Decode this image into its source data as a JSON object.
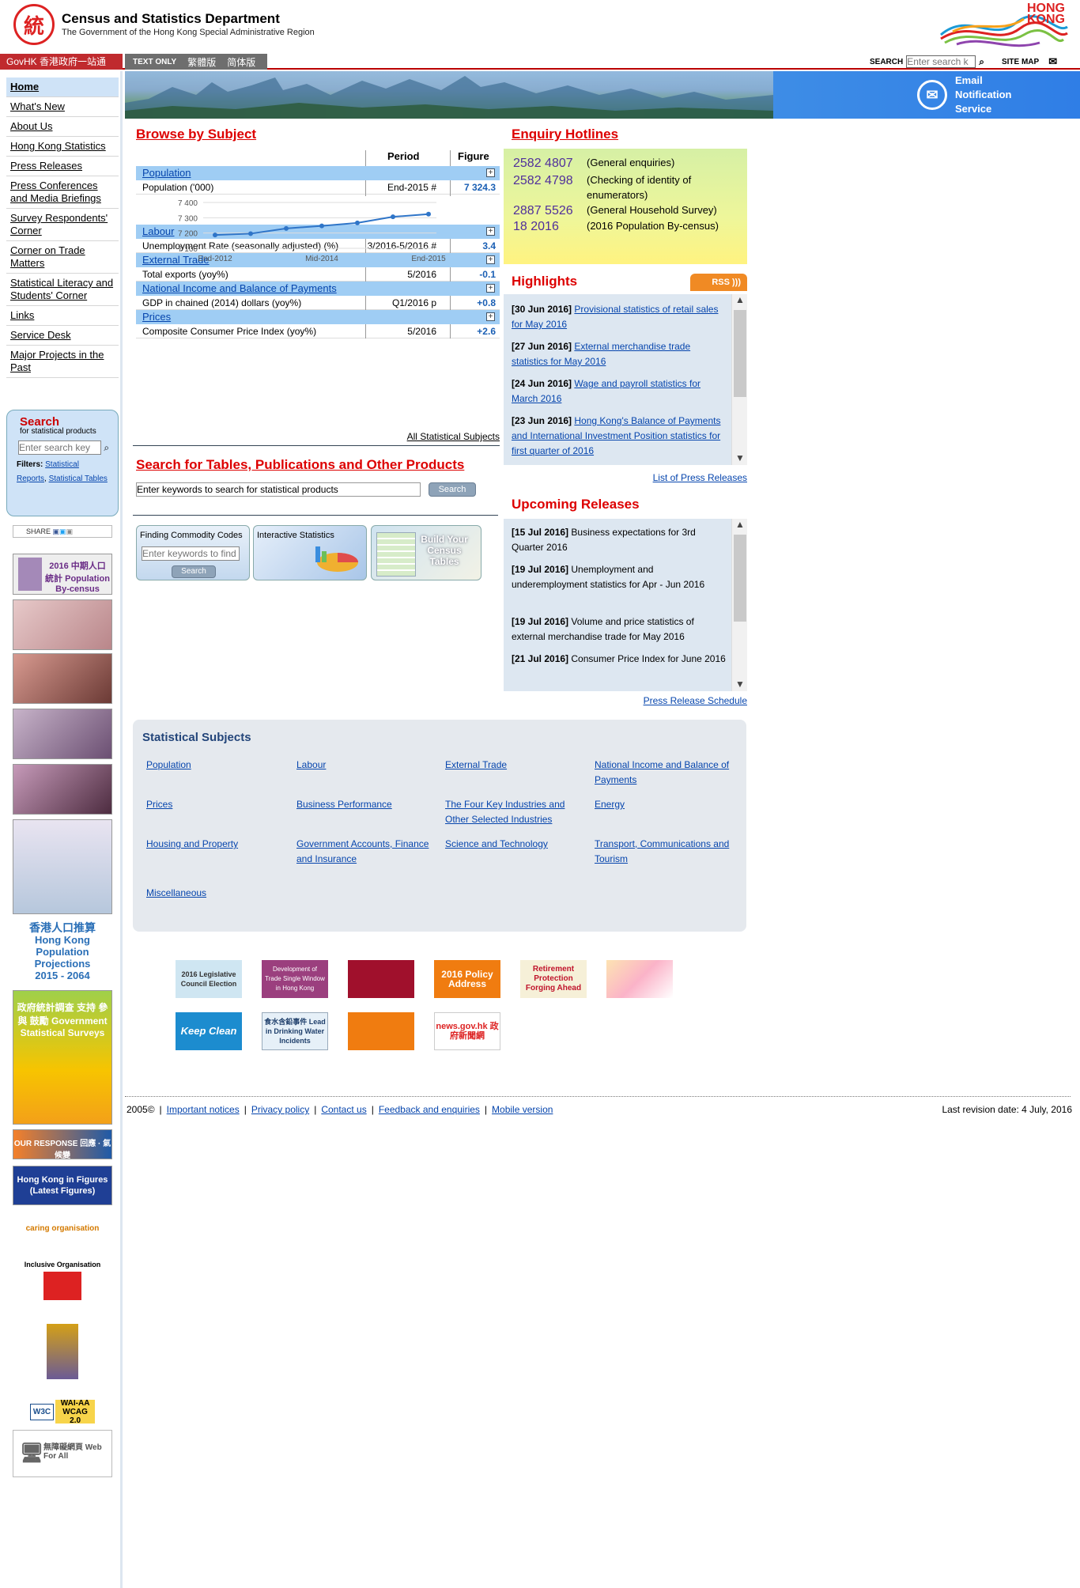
{
  "header": {
    "dept_name": "Census and Statistics Department",
    "dept_sub": "The Government of the Hong Kong Special Administrative Region",
    "brand": "HONG KONG",
    "govhk": "GovHK 香港政府一站通",
    "text_only": "TEXT ONLY",
    "lang_tc": "繁體版",
    "lang_sc": "简体版",
    "search_label": "SEARCH",
    "search_placeholder": "Enter search k",
    "sitemap": "SITE MAP",
    "email_service": "Email Notification Service"
  },
  "nav": [
    "Home",
    "What's New",
    "About Us",
    "Hong Kong Statistics",
    "Press Releases",
    "Press Conferences and Media Briefings",
    "Survey Respondents' Corner",
    "Corner on Trade Matters",
    "Statistical Literacy and Students' Corner",
    "Links",
    "Service Desk",
    "Major Projects in the Past"
  ],
  "left_search": {
    "title": "Search",
    "subtitle": "for statistical products",
    "placeholder": "Enter search key",
    "filters_label": "Filters:",
    "filter1": "Statistical Reports",
    "filter2": "Statistical Tables"
  },
  "share": "SHARE",
  "banners": {
    "census": "2016 中期人口統計 Population By-census",
    "projections_zh": "香港人口推算",
    "projections_en": "Hong Kong Population Projections",
    "projections_years": "2015 - 2064",
    "surveys": "政府統計調查 支持 參與 鼓勵 Government Statistical Surveys",
    "response": "OUR RESPONSE 回應 · 氣候變",
    "figures": "Hong Kong in Figures (Latest Figures)",
    "caring": "caring organisation",
    "inclusive": "Inclusive Organisation",
    "wai": "WAI-AA WCAG 2.0",
    "webforall": "無障礙網頁 Web For All"
  },
  "browse": {
    "title": "Browse by Subject",
    "col_period": "Period",
    "col_figure": "Figure",
    "subjects": [
      {
        "name": "Population",
        "indicator": "Population ('000)",
        "period": "End-2015 #",
        "figure": "7 324.3"
      },
      {
        "name": "Labour",
        "indicator": "Unemployment Rate (seasonally adjusted) (%)",
        "period": "3/2016-5/2016 #",
        "figure": "3.4"
      },
      {
        "name": "External Trade",
        "indicator": "Total exports (yoy%)",
        "period": "5/2016",
        "figure": "-0.1"
      },
      {
        "name": "National Income and Balance of Payments",
        "indicator": "GDP in chained (2014) dollars (yoy%)",
        "period": "Q1/2016 p",
        "figure": "+0.8"
      },
      {
        "name": "Prices",
        "indicator": "Composite Consumer Price Index (yoy%)",
        "period": "5/2016",
        "figure": "+2.6"
      }
    ],
    "all_subjects": "All Statistical Subjects"
  },
  "chart_data": {
    "type": "line",
    "title": "",
    "x": [
      "End-2012",
      "Mid-2013",
      "End-2013",
      "Mid-2014",
      "End-2014",
      "Mid-2015",
      "End-2015"
    ],
    "x_tick_labels": [
      "End-2012",
      "Mid-2014",
      "End-2015"
    ],
    "values": [
      7187,
      7196,
      7230,
      7247,
      7266,
      7306,
      7324
    ],
    "ylim": [
      7100,
      7400
    ],
    "y_ticks": [
      "7 400",
      "7 300",
      "7 200",
      "7 100"
    ],
    "y_tick_values": [
      7400,
      7300,
      7200,
      7100
    ],
    "grid": true,
    "color": "#2f75c8"
  },
  "search_products": {
    "title": "Search for Tables, Publications and Other Products",
    "placeholder": "Enter keywords to search for statistical products",
    "button": "Search"
  },
  "tiles": {
    "commodity": "Finding Commodity Codes",
    "commodity_placeholder": "Enter keywords to find",
    "commodity_btn": "Search",
    "interactive": "Interactive Statistics",
    "census_tables": "Build Your Census Tables"
  },
  "enquiry": {
    "title": "Enquiry Hotlines",
    "rows": [
      {
        "num": "2582 4807",
        "desc": "(General enquiries)"
      },
      {
        "num": "2582 4798",
        "desc": "(Checking of identity of enumerators)"
      },
      {
        "num": "2887 5526",
        "desc": "(General Household Survey)"
      },
      {
        "num": "18 2016",
        "desc": "(2016 Population By-census)"
      }
    ]
  },
  "highlights": {
    "title": "Highlights",
    "rss": "RSS",
    "items": [
      {
        "date": "[30 Jun 2016]",
        "text": "Provisional statistics of retail sales for May 2016"
      },
      {
        "date": "[27 Jun 2016]",
        "text": "External merchandise trade statistics for May 2016"
      },
      {
        "date": "[24 Jun 2016]",
        "text": "Wage and payroll statistics for March 2016"
      },
      {
        "date": "[23 Jun 2016]",
        "text": "Hong Kong's Balance of Payments and International Investment Position statistics for first quarter of 2016"
      }
    ],
    "list_link": "List of Press Releases"
  },
  "upcoming": {
    "title": "Upcoming Releases",
    "items": [
      {
        "date": "[15 Jul 2016]",
        "text": "Business expectations for 3rd Quarter 2016"
      },
      {
        "date": "[19 Jul 2016]",
        "text": "Unemployment and underemployment statistics for Apr - Jun 2016"
      },
      {
        "date": "[19 Jul 2016]",
        "text": "Volume and price statistics of external merchandise trade for May 2016"
      },
      {
        "date": "[21 Jul 2016]",
        "text": "Consumer Price Index for June 2016"
      }
    ],
    "schedule_link": "Press Release Schedule"
  },
  "stat_subjects": {
    "title": "Statistical Subjects",
    "links": [
      "Population",
      "Labour",
      "External Trade",
      "National Income and Balance of Payments",
      "Prices",
      "Business Performance",
      "The Four Key Industries and Other Selected Industries",
      "Energy",
      "Housing and Property",
      "Government Accounts, Finance and Insurance",
      "Science and Technology",
      "Transport, Communications and Tourism",
      "Miscellaneous"
    ]
  },
  "footer_logos": {
    "legco": "2016 Legislative Council Election",
    "trade_window": "Development of Trade Single Window in Hong Kong",
    "policy": "2016 Policy Address",
    "retirement": "Retirement Protection Forging Ahead",
    "keep_clean": "Keep Clean",
    "lead": "食水含鉛事件 Lead in Drinking Water Incidents",
    "news": "news.gov.hk 政府新聞網"
  },
  "footer": {
    "copyright": "2005©",
    "links": [
      "Important notices",
      "Privacy policy",
      "Contact us",
      "Feedback and enquiries",
      "Mobile version"
    ],
    "revision": "Last revision date: 4 July, 2016"
  }
}
